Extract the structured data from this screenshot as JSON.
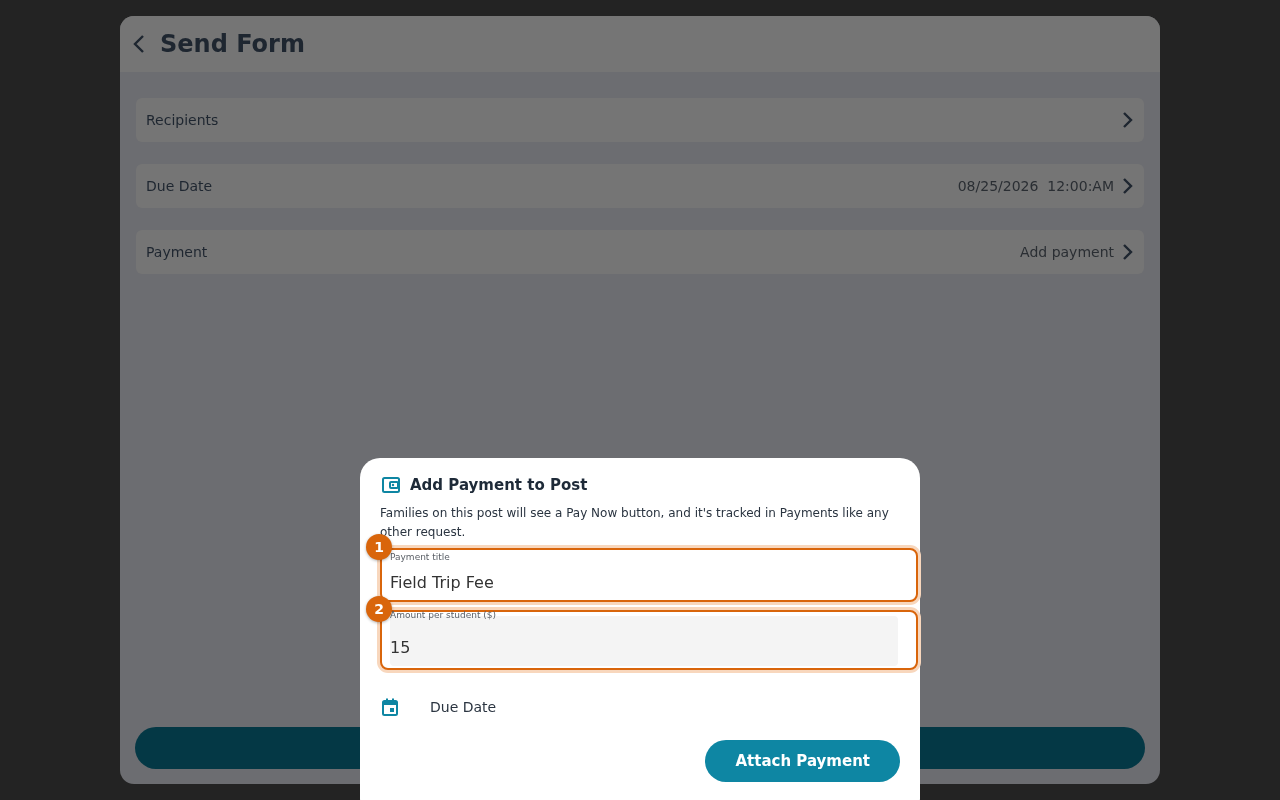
{
  "send_form": {
    "title": "Send Form",
    "rows": [
      {
        "label": "Recipients"
      },
      {
        "label": "Due Date",
        "value": "08/25/2026  12:00:AM"
      },
      {
        "label": "Payment",
        "value": "Add payment"
      }
    ]
  },
  "payment_dialog": {
    "title": "Add Payment to Post",
    "description": "Families on this post will see a Pay Now button, and it's tracked in Payments like any other request.",
    "fields": [
      {
        "callout": "1",
        "label": "Payment title",
        "value": "Field Trip Fee",
        "kind": "outlined"
      },
      {
        "callout": "2",
        "label": "Amount per student ($)",
        "value": "15",
        "kind": "filled"
      }
    ],
    "due_date": {
      "label": "Due Date"
    },
    "button": "Attach Payment"
  }
}
